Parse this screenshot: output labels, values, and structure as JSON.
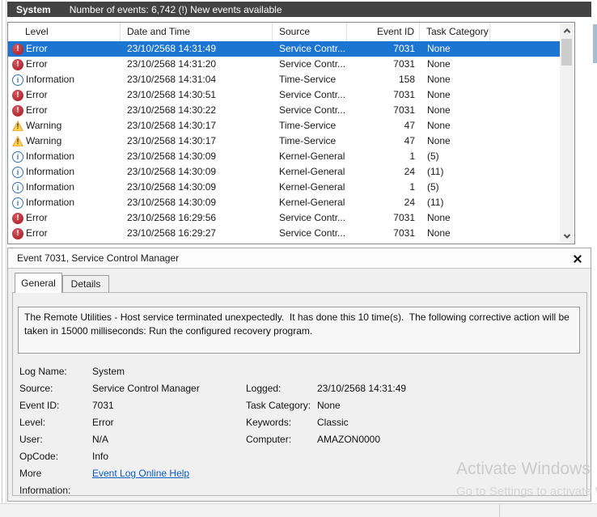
{
  "titlebar": {
    "log_name": "System",
    "status": "Number of events: 6,742 (!) New events available"
  },
  "table": {
    "columns": [
      "Level",
      "Date and Time",
      "Source",
      "Event ID",
      "Task Category"
    ],
    "rows": [
      {
        "level": "Error",
        "icon": "error",
        "date": "23/10/2568 14:31:49",
        "source": "Service Contr...",
        "event_id": "7031",
        "task": "None",
        "selected": true
      },
      {
        "level": "Error",
        "icon": "error",
        "date": "23/10/2568 14:31:20",
        "source": "Service Contr...",
        "event_id": "7031",
        "task": "None"
      },
      {
        "level": "Information",
        "icon": "information",
        "date": "23/10/2568 14:31:04",
        "source": "Time-Service",
        "event_id": "158",
        "task": "None"
      },
      {
        "level": "Error",
        "icon": "error",
        "date": "23/10/2568 14:30:51",
        "source": "Service Contr...",
        "event_id": "7031",
        "task": "None"
      },
      {
        "level": "Error",
        "icon": "error",
        "date": "23/10/2568 14:30:22",
        "source": "Service Contr...",
        "event_id": "7031",
        "task": "None"
      },
      {
        "level": "Warning",
        "icon": "warning",
        "date": "23/10/2568 14:30:17",
        "source": "Time-Service",
        "event_id": "47",
        "task": "None"
      },
      {
        "level": "Warning",
        "icon": "warning",
        "date": "23/10/2568 14:30:17",
        "source": "Time-Service",
        "event_id": "47",
        "task": "None"
      },
      {
        "level": "Information",
        "icon": "information",
        "date": "23/10/2568 14:30:09",
        "source": "Kernel-General",
        "event_id": "1",
        "task": "(5)"
      },
      {
        "level": "Information",
        "icon": "information",
        "date": "23/10/2568 14:30:09",
        "source": "Kernel-General",
        "event_id": "24",
        "task": "(11)"
      },
      {
        "level": "Information",
        "icon": "information",
        "date": "23/10/2568 14:30:09",
        "source": "Kernel-General",
        "event_id": "1",
        "task": "(5)"
      },
      {
        "level": "Information",
        "icon": "information",
        "date": "23/10/2568 14:30:09",
        "source": "Kernel-General",
        "event_id": "24",
        "task": "(11)"
      },
      {
        "level": "Error",
        "icon": "error",
        "date": "23/10/2568 16:29:56",
        "source": "Service Contr...",
        "event_id": "7031",
        "task": "None"
      },
      {
        "level": "Error",
        "icon": "error",
        "date": "23/10/2568 16:29:27",
        "source": "Service Contr...",
        "event_id": "7031",
        "task": "None"
      }
    ]
  },
  "detail": {
    "header_title": "Event 7031, Service Control Manager",
    "tabs": [
      {
        "label": "General",
        "active": true
      },
      {
        "label": "Details",
        "active": false
      }
    ],
    "description": "The Remote Utilities - Host service terminated unexpectedly.  It has done this 10 time(s).  The following corrective action will be taken in 15000 milliseconds: Run the configured recovery program.",
    "info_rows": [
      {
        "l": "Log Name:",
        "lv": "System",
        "r": "",
        "rv": ""
      },
      {
        "l": "Source:",
        "lv": "Service Control Manager",
        "r": "Logged:",
        "rv": "23/10/2568 14:31:49"
      },
      {
        "l": "Event ID:",
        "lv": "7031",
        "r": "Task Category:",
        "rv": "None"
      },
      {
        "l": "Level:",
        "lv": "Error",
        "r": "Keywords:",
        "rv": "Classic"
      },
      {
        "l": "User:",
        "lv": "N/A",
        "r": "Computer:",
        "rv": "AMAZON0000"
      },
      {
        "l": "OpCode:",
        "lv": "Info",
        "r": "",
        "rv": ""
      }
    ],
    "more_info": {
      "label": "More Information:",
      "link_text": "Event Log Online Help"
    }
  },
  "watermark": {
    "line1": "Activate Windows",
    "line2": "Go to Settings to activate W"
  },
  "colors": {
    "selection": "#1b75d1",
    "topbar": "#434343",
    "error": "#b02a33",
    "warning": "#ffd24a",
    "info_border": "#2f6fb2",
    "link": "#0a5dc2"
  }
}
